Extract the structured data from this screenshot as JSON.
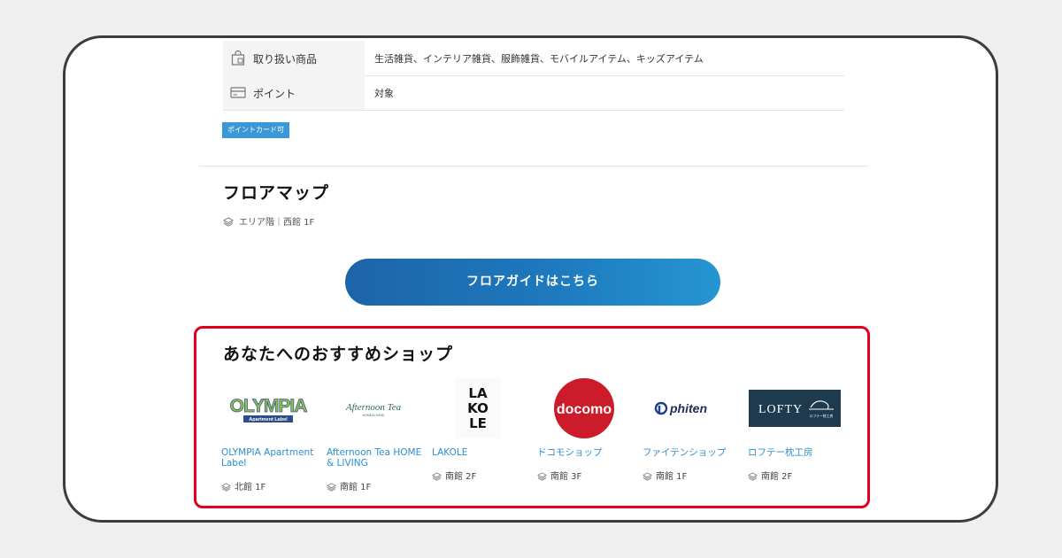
{
  "info_rows": [
    {
      "label": "取り扱い商品",
      "value": "生活雑貨、インテリア雑貨、服飾雑貨、モバイルアイテム、キッズアイテム",
      "icon": "shopping-bag-icon"
    },
    {
      "label": "ポイント",
      "value": "対象",
      "icon": "card-icon"
    }
  ],
  "badge": "ポイントカード可",
  "floor_map": {
    "title": "フロアマップ",
    "area_label": "エリア階｜",
    "area_value": "西館 1F",
    "guide_button": "フロアガイドはこちら"
  },
  "recommend": {
    "title": "あなたへのおすすめショップ",
    "shops": [
      {
        "name": "OLYMPIA Apartment Label",
        "floor": "北館 1F",
        "logo_text": "OLYMPIA",
        "logo_sub": "Apartment Label"
      },
      {
        "name": "Afternoon Tea HOME & LIVING",
        "floor": "南館 1F",
        "logo_text": "Afternoon Tea",
        "logo_sub": "HOME&LIVING"
      },
      {
        "name": "LAKOLE",
        "floor": "南館 2F",
        "logo_text": "LAKOLE",
        "logo_lines": [
          "LA",
          "KO",
          "LE"
        ]
      },
      {
        "name": "ドコモショップ",
        "floor": "南館 3F",
        "logo_text": "docomo"
      },
      {
        "name": "ファイテンショップ",
        "floor": "南館 1F",
        "logo_text": "phiten"
      },
      {
        "name": "ロフテー枕工房",
        "floor": "南館 2F",
        "logo_text": "LOFTY",
        "logo_sub": "ロフテー枕工房"
      }
    ]
  },
  "colors": {
    "accent_blue": "#2c8fd0",
    "highlight_red": "#e0001e",
    "docomo_red": "#cc1b2b",
    "lofty_navy": "#1e3a4f"
  }
}
